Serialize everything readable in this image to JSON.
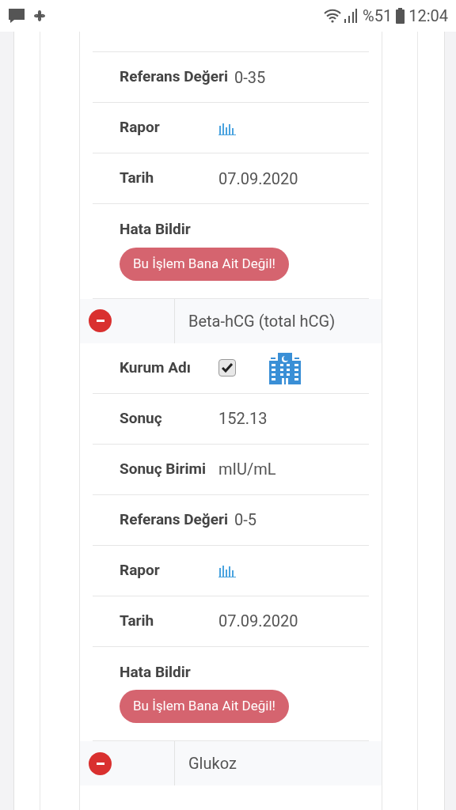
{
  "status_bar": {
    "battery": "%51",
    "time": "12:04"
  },
  "groups": [
    {
      "fields": [
        {
          "kind": "text",
          "label": "Referans Değeri",
          "value": "0-35"
        },
        {
          "kind": "chart",
          "label": "Rapor"
        },
        {
          "kind": "text",
          "label": "Tarih",
          "value": "07.09.2020"
        },
        {
          "kind": "error",
          "label": "Hata Bildir",
          "button": "Bu İşlem Bana Ait Değil!"
        }
      ]
    },
    {
      "name": "Beta-hCG (total hCG)",
      "expanded": true,
      "fields": [
        {
          "kind": "institution",
          "label": "Kurum Adı",
          "checked": true
        },
        {
          "kind": "text",
          "label": "Sonuç",
          "value": "152.13"
        },
        {
          "kind": "text",
          "label": "Sonuç Birimi",
          "value": "mIU/mL"
        },
        {
          "kind": "text",
          "label": "Referans Değeri",
          "value": "0-5"
        },
        {
          "kind": "chart",
          "label": "Rapor"
        },
        {
          "kind": "text",
          "label": "Tarih",
          "value": "07.09.2020"
        },
        {
          "kind": "error",
          "label": "Hata Bildir",
          "button": "Bu İşlem Bana Ait Değil!"
        }
      ]
    },
    {
      "name": "Glukoz",
      "expanded": true
    }
  ]
}
